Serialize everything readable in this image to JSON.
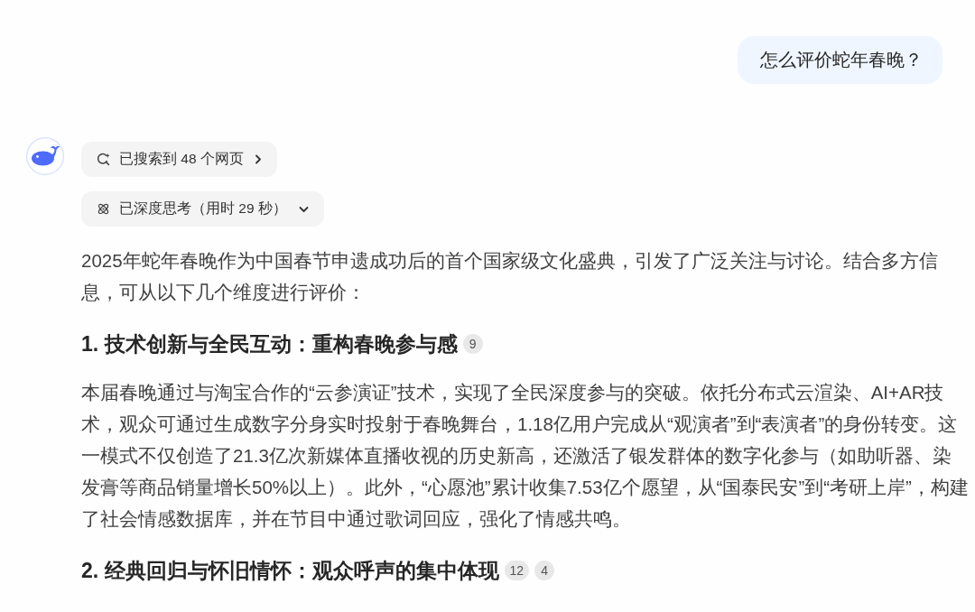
{
  "user_message": {
    "text": "怎么评价蛇年春晚？"
  },
  "response": {
    "status_chips": [
      {
        "kind": "search",
        "label": "已搜索到 48 个网页"
      },
      {
        "kind": "thinking",
        "label": "已深度思考（用时 29 秒）"
      }
    ],
    "blocks": [
      {
        "kind": "paragraph",
        "text": "2025年蛇年春晚作为中国春节申遗成功后的首个国家级文化盛典，引发了广泛关注与讨论。结合多方信息，可从以下几个维度进行评价："
      },
      {
        "kind": "heading",
        "text": "1. 技术创新与全民互动：重构春晚参与感",
        "citations": [
          "9"
        ]
      },
      {
        "kind": "paragraph",
        "text": "本届春晚通过与淘宝合作的“云参演证”技术，实现了全民深度参与的突破。依托分布式云渲染、AI+AR技术，观众可通过生成数字分身实时投射于春晚舞台，1.18亿用户完成从“观演者”到“表演者”的身份转变。这一模式不仅创造了21.3亿次新媒体直播收视的历史新高，还激活了银发群体的数字化参与（如助听器、染发膏等商品销量增长50%以上）。此外，“心愿池”累计收集7.53亿个愿望，从“国泰民安”到“考研上岸”，构建了社会情感数据库，并在节目中通过歌词回应，强化了情感共鸣。"
      },
      {
        "kind": "heading",
        "text": "2. 经典回归与怀旧情怀：观众呼声的集中体现",
        "citations": [
          "12",
          "4"
        ]
      }
    ]
  }
}
